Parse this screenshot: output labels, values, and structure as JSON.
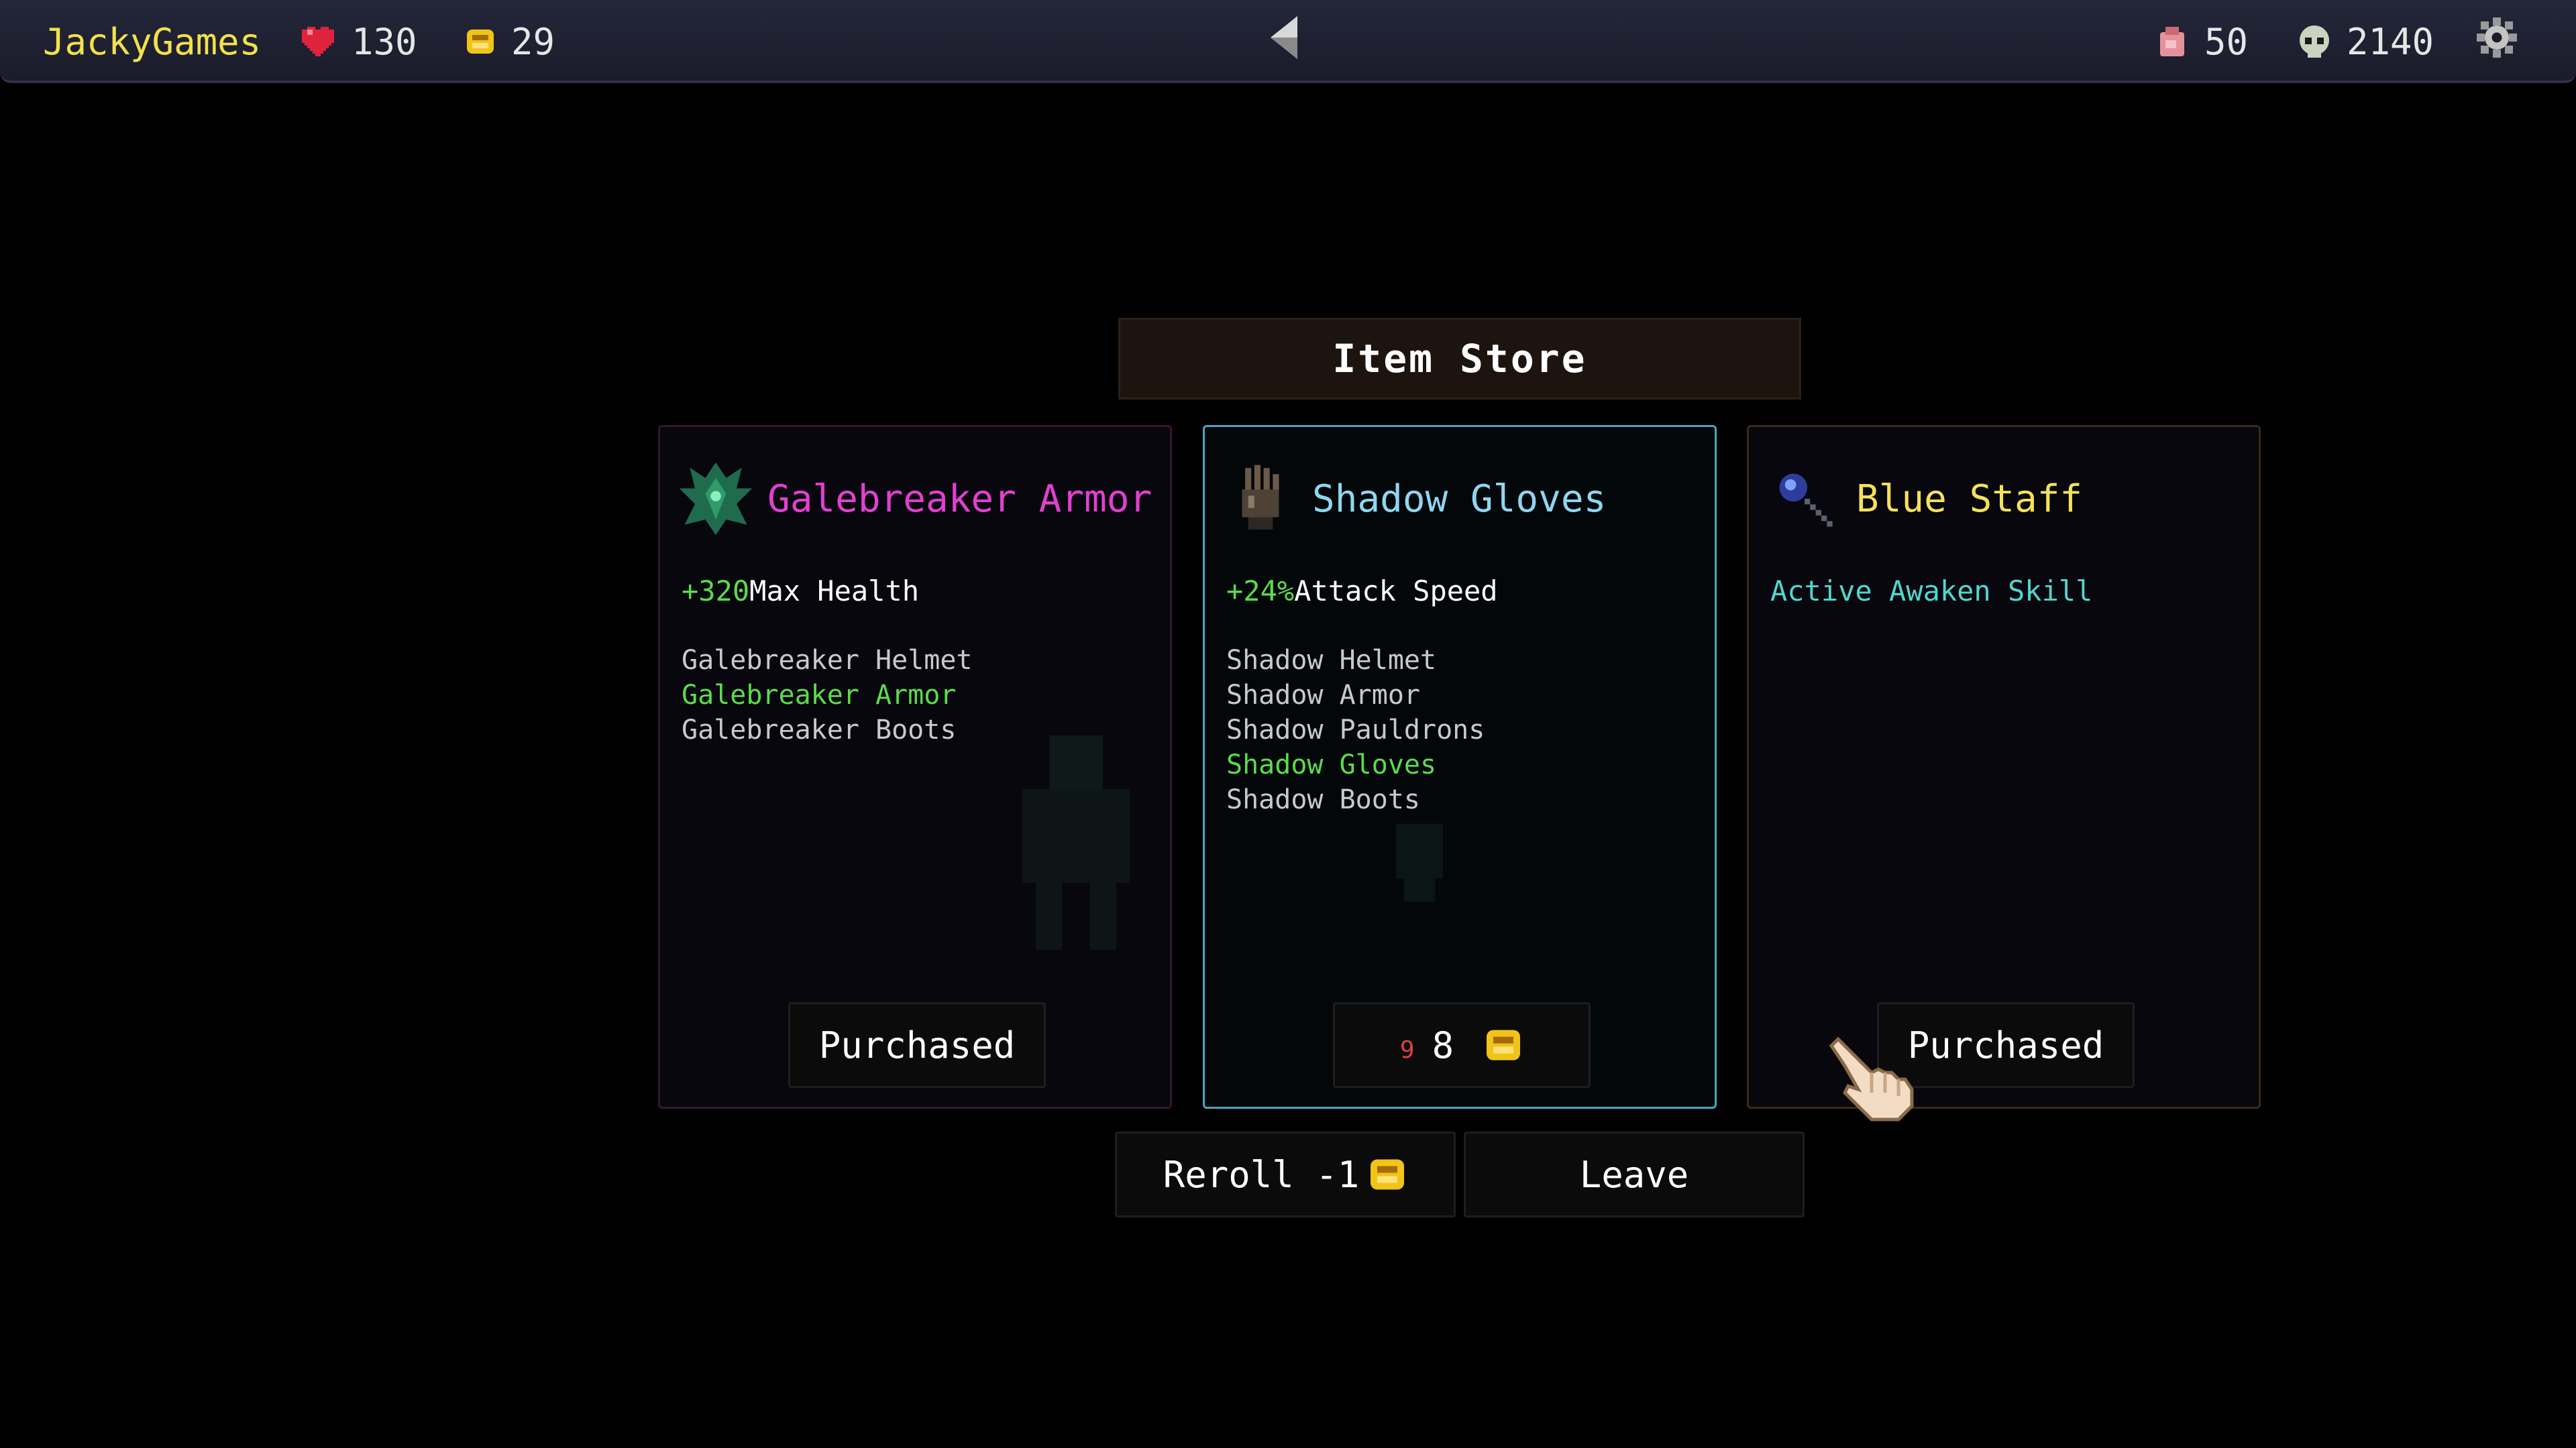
{
  "topbar": {
    "player_name": "JackyGames",
    "health": "130",
    "gold": "29",
    "bag_count": "50",
    "kill_count": "2140"
  },
  "store": {
    "title": "Item Store",
    "cards": [
      {
        "name": "Galebreaker Armor",
        "name_color": "#e23fd1",
        "stat_value": "+320",
        "stat_label": "Max Health",
        "set_items": [
          "Galebreaker Helmet",
          "Galebreaker Armor",
          "Galebreaker Boots"
        ],
        "active_set_item": "Galebreaker Armor",
        "button_label": "Purchased"
      },
      {
        "name": "Shadow Gloves",
        "name_color": "#8fd6ee",
        "stat_value": "+24%",
        "stat_label": "Attack Speed",
        "set_items": [
          "Shadow Helmet",
          "Shadow Armor",
          "Shadow Pauldrons",
          "Shadow Gloves",
          "Shadow Boots"
        ],
        "active_set_item": "Shadow Gloves",
        "original_price": "9",
        "price": "8"
      },
      {
        "name": "Blue Staff",
        "name_color": "#f5e25a",
        "ability": "Active Awaken Skill",
        "button_label": "Purchased"
      }
    ]
  },
  "actions": {
    "reroll_label": "Reroll -1",
    "leave_label": "Leave"
  },
  "icons": {
    "health": "heart-icon",
    "gold": "coin-icon",
    "bag": "bag-icon",
    "kills": "skull-icon",
    "back": "left-arrow-icon",
    "settings": "gear-icon",
    "cursor": "pointing-hand-icon"
  },
  "colors": {
    "player_name": "#f2e14a",
    "set_bonus_active": "#5bdc4a",
    "price_strike": "#e34141",
    "coin": "#f0c419"
  }
}
